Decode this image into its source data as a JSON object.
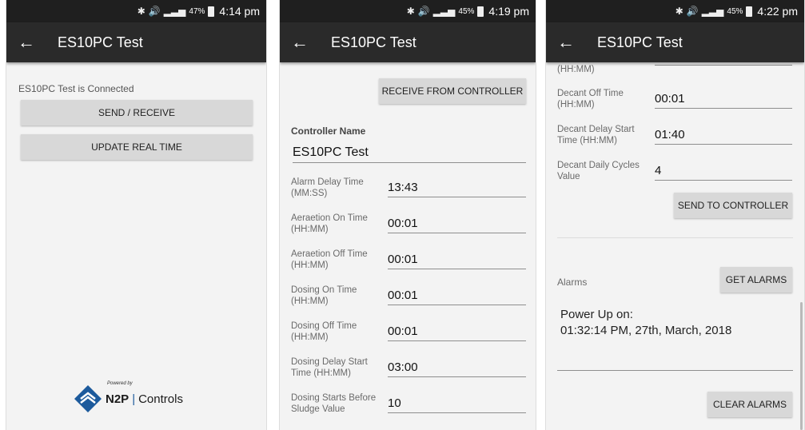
{
  "screens": [
    {
      "status": {
        "percent": "47%",
        "time": "4:14 pm"
      },
      "appbar": {
        "back_icon": "arrow-left-icon",
        "title": "ES10PC Test"
      },
      "connection_text": "ES10PC Test is Connected",
      "buttons": {
        "send_receive": "SEND / RECEIVE",
        "update_real_time": "UPDATE REAL TIME"
      },
      "logo": {
        "powered_by": "Powered by",
        "brand_left": "N2P",
        "brand_sep": "|",
        "brand_right": "Controls"
      }
    },
    {
      "status": {
        "percent": "45%",
        "time": "4:19 pm"
      },
      "appbar": {
        "back_icon": "arrow-left-icon",
        "title": "ES10PC Test"
      },
      "receive_button": "RECEIVE FROM CONTROLLER",
      "controller_name": {
        "label": "Controller Name",
        "value": "ES10PC Test"
      },
      "fields": [
        {
          "label": "Alarm Delay Time (MM:SS)",
          "value": "13:43"
        },
        {
          "label": "Aeraetion On Time (HH:MM)",
          "value": "00:01"
        },
        {
          "label": "Aeraetion Off Time (HH:MM)",
          "value": "00:01"
        },
        {
          "label": "Dosing On Time (HH:MM)",
          "value": "00:01"
        },
        {
          "label": "Dosing Off Time (HH:MM)",
          "value": "00:01"
        },
        {
          "label": "Dosing Delay Start Time (HH:MM)",
          "value": "03:00"
        },
        {
          "label": "Dosing Starts Before Sludge Value",
          "value": "10"
        }
      ]
    },
    {
      "status": {
        "percent": "45%",
        "time": "4:22 pm"
      },
      "appbar": {
        "back_icon": "arrow-left-icon",
        "title": "ES10PC Test"
      },
      "partial_label": "(HH:MM)",
      "fields": [
        {
          "label": "Decant Off Time (HH:MM)",
          "value": "00:01"
        },
        {
          "label": "Decant Delay Start Time (HH:MM)",
          "value": "01:40"
        },
        {
          "label": "Decant Daily Cycles Value",
          "value": "4"
        }
      ],
      "send_button": "SEND TO CONTROLLER",
      "alarms": {
        "label": "Alarms",
        "get_button": "GET ALARMS",
        "line1": "Power Up on:",
        "line2": "01:32:14 PM, 27th, March, 2018",
        "clear_button": "CLEAR ALARMS"
      }
    }
  ]
}
